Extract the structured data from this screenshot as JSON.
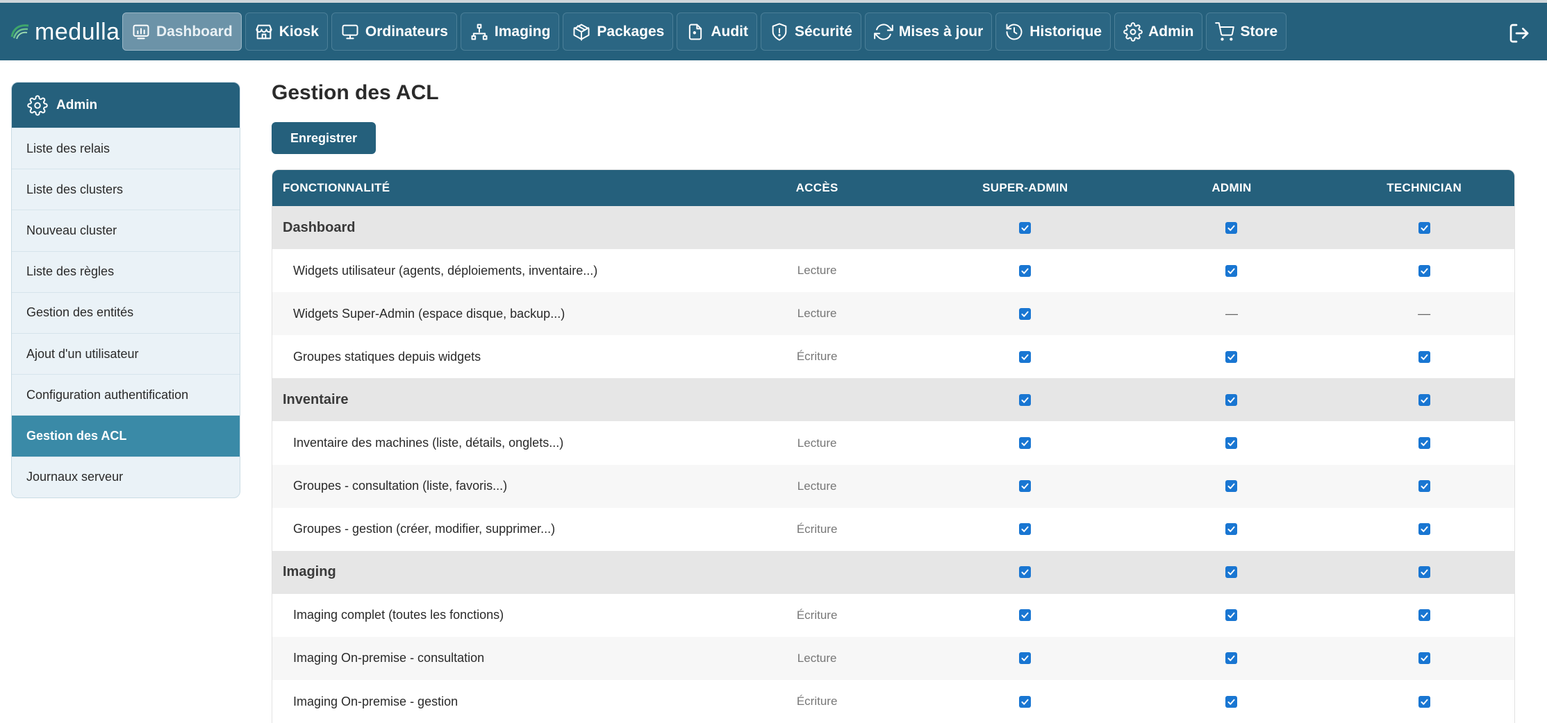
{
  "app": {
    "logo_text": "medulla"
  },
  "nav": [
    {
      "label": "Dashboard",
      "icon": "dashboard-icon",
      "active": true
    },
    {
      "label": "Kiosk",
      "icon": "kiosk-icon"
    },
    {
      "label": "Ordinateurs",
      "icon": "monitor-icon"
    },
    {
      "label": "Imaging",
      "icon": "network-icon"
    },
    {
      "label": "Packages",
      "icon": "package-icon"
    },
    {
      "label": "Audit",
      "icon": "audit-icon"
    },
    {
      "label": "Sécurité",
      "icon": "shield-icon"
    },
    {
      "label": "Mises à jour",
      "icon": "refresh-icon"
    },
    {
      "label": "Historique",
      "icon": "history-icon"
    },
    {
      "label": "Admin",
      "icon": "gear-icon"
    },
    {
      "label": "Store",
      "icon": "cart-icon"
    }
  ],
  "sidebar": {
    "title": "Admin",
    "items": [
      {
        "label": "Liste des relais"
      },
      {
        "label": "Liste des clusters"
      },
      {
        "label": "Nouveau cluster"
      },
      {
        "label": "Liste des règles"
      },
      {
        "label": "Gestion des entités"
      },
      {
        "label": "Ajout d'un utilisateur"
      },
      {
        "label": "Configuration authentification"
      },
      {
        "label": "Gestion des ACL",
        "active": true
      },
      {
        "label": "Journaux serveur"
      }
    ]
  },
  "main": {
    "title": "Gestion des ACL",
    "save_label": "Enregistrer"
  },
  "table": {
    "headers": {
      "feature": "FONCTIONNALITÉ",
      "access": "ACCÈS",
      "super_admin": "SUPER-ADMIN",
      "admin": "ADMIN",
      "technician": "TECHNICIAN"
    },
    "rows": [
      {
        "type": "group",
        "feature": "Dashboard",
        "access": "",
        "super_admin": true,
        "admin": true,
        "technician": true
      },
      {
        "type": "item",
        "feature": "Widgets utilisateur (agents, déploiements, inventaire...)",
        "access": "Lecture",
        "super_admin": true,
        "admin": true,
        "technician": true
      },
      {
        "type": "item",
        "feature": "Widgets Super-Admin (espace disque, backup...)",
        "access": "Lecture",
        "super_admin": true,
        "admin": "—",
        "technician": "—"
      },
      {
        "type": "item",
        "feature": "Groupes statiques depuis widgets",
        "access": "Écriture",
        "super_admin": true,
        "admin": true,
        "technician": true
      },
      {
        "type": "group",
        "feature": "Inventaire",
        "access": "",
        "super_admin": true,
        "admin": true,
        "technician": true
      },
      {
        "type": "item",
        "feature": "Inventaire des machines (liste, détails, onglets...)",
        "access": "Lecture",
        "super_admin": true,
        "admin": true,
        "technician": true
      },
      {
        "type": "item",
        "feature": "Groupes - consultation (liste, favoris...)",
        "access": "Lecture",
        "super_admin": true,
        "admin": true,
        "technician": true
      },
      {
        "type": "item",
        "feature": "Groupes - gestion (créer, modifier, supprimer...)",
        "access": "Écriture",
        "super_admin": true,
        "admin": true,
        "technician": true
      },
      {
        "type": "group",
        "feature": "Imaging",
        "access": "",
        "super_admin": true,
        "admin": true,
        "technician": true
      },
      {
        "type": "item",
        "feature": "Imaging complet (toutes les fonctions)",
        "access": "Écriture",
        "super_admin": true,
        "admin": true,
        "technician": true
      },
      {
        "type": "item",
        "feature": "Imaging On-premise - consultation",
        "access": "Lecture",
        "super_admin": true,
        "admin": true,
        "technician": true
      },
      {
        "type": "item",
        "feature": "Imaging On-premise - gestion",
        "access": "Écriture",
        "super_admin": true,
        "admin": true,
        "technician": true
      }
    ]
  },
  "colors": {
    "primary": "#25607c",
    "active_sidebar": "#3a8aa7",
    "checkbox": "#1976d2"
  }
}
